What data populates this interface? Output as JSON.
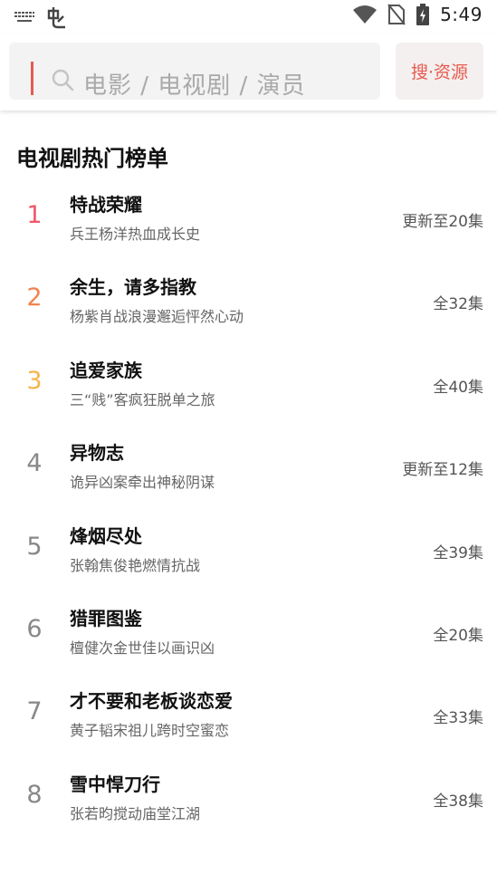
{
  "status_bar": {
    "time": "5:49",
    "icons": [
      "keyboard-icon",
      "bug-icon",
      "wifi-icon",
      "no-sim-icon",
      "battery-charging-icon"
    ]
  },
  "search": {
    "placeholder": "电影 / 电视剧 / 演员",
    "button_label": "搜·资源",
    "accent_color": "#e85a4f"
  },
  "section": {
    "title": "电视剧热门榜单"
  },
  "rank_colors": [
    "#f0566a",
    "#f3824f",
    "#f5b54a",
    "#888888"
  ],
  "items": [
    {
      "rank": "1",
      "title": "特战荣耀",
      "desc": "兵王杨洋热血成长史",
      "status": "更新至20集"
    },
    {
      "rank": "2",
      "title": "余生，请多指教",
      "desc": "杨紫肖战浪漫邂逅怦然心动",
      "status": "全32集"
    },
    {
      "rank": "3",
      "title": "追爱家族",
      "desc": "三“贱”客疯狂脱单之旅",
      "status": "全40集"
    },
    {
      "rank": "4",
      "title": "异物志",
      "desc": "诡异凶案牵出神秘阴谋",
      "status": "更新至12集"
    },
    {
      "rank": "5",
      "title": "烽烟尽处",
      "desc": "张翰焦俊艳燃情抗战",
      "status": "全39集"
    },
    {
      "rank": "6",
      "title": "猎罪图鉴",
      "desc": "檀健次金世佳以画识凶",
      "status": "全20集"
    },
    {
      "rank": "7",
      "title": "才不要和老板谈恋爱",
      "desc": "黄子韬宋祖儿跨时空蜜恋",
      "status": "全33集"
    },
    {
      "rank": "8",
      "title": "雪中悍刀行",
      "desc": "张若昀搅动庙堂江湖",
      "status": "全38集"
    }
  ]
}
